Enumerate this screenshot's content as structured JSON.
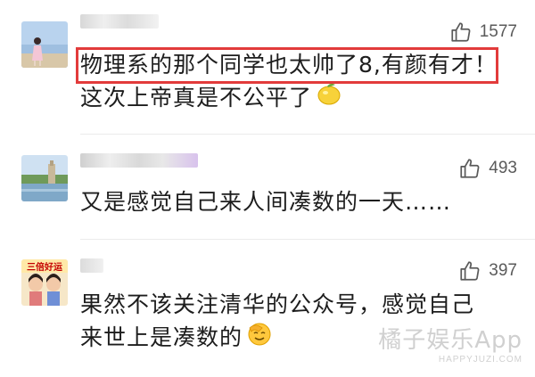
{
  "comments": [
    {
      "likes": "1577",
      "lines": [
        "物理系的那个同学也太帅了8,有颜有才！",
        "这次上帝真是不公平了"
      ],
      "emoji": "lemon-emoji"
    },
    {
      "likes": "493",
      "lines": [
        "又是感觉自己来人间凑数的一天……"
      ]
    },
    {
      "likes": "397",
      "avatar_badge": "三倍好运",
      "lines": [
        "果然不该关注清华的公众号，感觉自己",
        "来世上是凑数的"
      ],
      "emoji": "facepalm-emoji"
    }
  ],
  "watermark": {
    "main": "橘子娱乐App",
    "sub": "HAPPYJUZI.COM"
  },
  "colors": {
    "highlight": "#e23b3b",
    "like_text": "#5a5a5a"
  },
  "icons": [
    "thumbs-up-icon",
    "lemon-emoji",
    "facepalm-emoji"
  ]
}
